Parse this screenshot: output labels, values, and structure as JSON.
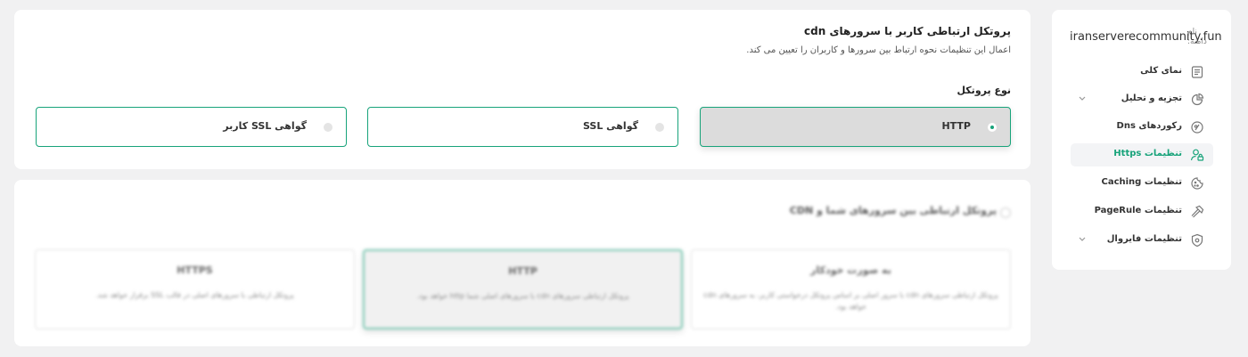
{
  "sidebar": {
    "domain_label": "نام دامنه:",
    "domain_value": "iranserverecommunity.fun",
    "items": [
      {
        "label": "نمای کلی",
        "icon": "overview-icon",
        "has_chevron": false,
        "active": false
      },
      {
        "label": "تجزیه و تحلیل",
        "icon": "analytics-icon",
        "has_chevron": true,
        "active": false
      },
      {
        "label": "رکوردهای Dns",
        "icon": "dns-icon",
        "has_chevron": false,
        "active": false
      },
      {
        "label": "تنظیمات Https",
        "icon": "https-icon",
        "has_chevron": false,
        "active": true
      },
      {
        "label": "تنظیمات Caching",
        "icon": "cookie-icon",
        "has_chevron": false,
        "active": false
      },
      {
        "label": "تنظیمات PageRule",
        "icon": "hammer-icon",
        "has_chevron": false,
        "active": false
      },
      {
        "label": "تنظیمات فایروال",
        "icon": "shield-icon",
        "has_chevron": true,
        "active": false
      }
    ]
  },
  "protocol_card": {
    "title": "پروتکل ارتباطی کاربر با سرورهای cdn",
    "subtitle": "اعمال این تنظیمات نحوه ارتباط بین سرورها و کاربران را تعیین می کند.",
    "type_label": "نوع پروتکل",
    "options": [
      {
        "label": "HTTP",
        "selected": true
      },
      {
        "label": "گواهی SSL",
        "selected": false
      },
      {
        "label": "گواهی SSL کاربر",
        "selected": false
      }
    ]
  },
  "origin_card": {
    "title": "پروتکل ارتباطی بین سرورهای شما و CDN",
    "options": [
      {
        "title": "به صورت خودکار",
        "desc": "پروتکل ارتباطی سرورهای cdn با سرور اصلی بر اساس پروتکل درخواستی کاربر، به سرورهای cdn خواهد بود.",
        "selected": false
      },
      {
        "title": "HTTP",
        "desc": "پروتکل ارتباطی سرورهای cdn با سرورهای اصلی شما http خواهد بود.",
        "selected": true
      },
      {
        "title": "HTTPS",
        "desc": "پروتکل ارتباطی با سرورهای اصلی در قالب SSL برقرار خواهد شد.",
        "selected": false
      }
    ]
  },
  "colors": {
    "accent": "#17a37a",
    "page_bg": "#f1f1f2",
    "selected_bg": "#dcdcdc"
  }
}
